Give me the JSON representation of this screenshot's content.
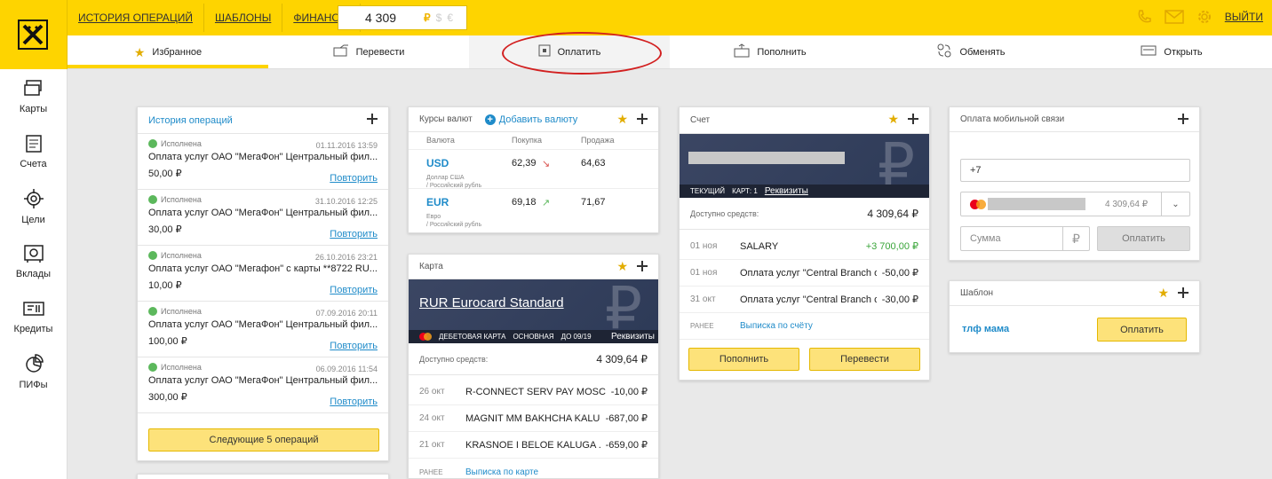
{
  "header": {
    "links": [
      "ИСТОРИЯ ОПЕРАЦИЙ",
      "ШАБЛОНЫ",
      "ФИНАНСЫ"
    ],
    "balance": "4 309",
    "currencies": [
      "₽",
      "$",
      "€"
    ],
    "logout": "ВЫЙТИ"
  },
  "tabs": [
    {
      "label": "Избранное",
      "icon": "star-icon"
    },
    {
      "label": "Перевести",
      "icon": "transfer-icon"
    },
    {
      "label": "Оплатить",
      "icon": "pay-icon"
    },
    {
      "label": "Пополнить",
      "icon": "topup-icon"
    },
    {
      "label": "Обменять",
      "icon": "exchange-icon"
    },
    {
      "label": "Открыть",
      "icon": "open-icon"
    }
  ],
  "sidebar": [
    {
      "label": "Карты",
      "icon": "cards-icon"
    },
    {
      "label": "Счета",
      "icon": "accounts-icon"
    },
    {
      "label": "Цели",
      "icon": "goals-icon"
    },
    {
      "label": "Вклады",
      "icon": "deposits-icon"
    },
    {
      "label": "Кредиты",
      "icon": "credits-icon"
    },
    {
      "label": "ПИФы",
      "icon": "funds-icon"
    }
  ],
  "history": {
    "title": "История операций",
    "items": [
      {
        "status": "Исполнена",
        "date": "01.11.2016 13:59",
        "desc": "Оплата услуг ОАО \"МегаФон\" Центральный фил...",
        "sum": "50,00 ₽",
        "action": "Повторить"
      },
      {
        "status": "Исполнена",
        "date": "31.10.2016 12:25",
        "desc": "Оплата услуг ОАО \"МегаФон\" Центральный фил...",
        "sum": "30,00 ₽",
        "action": "Повторить"
      },
      {
        "status": "Исполнена",
        "date": "26.10.2016 23:21",
        "desc": "Оплата услуг ОАО \"Мегафон\" с карты **8722 RU...",
        "sum": "10,00 ₽",
        "action": "Повторить"
      },
      {
        "status": "Исполнена",
        "date": "07.09.2016 20:11",
        "desc": "Оплата услуг ОАО \"МегаФон\" Центральный фил...",
        "sum": "100,00 ₽",
        "action": "Повторить"
      },
      {
        "status": "Исполнена",
        "date": "06.09.2016 11:54",
        "desc": "Оплата услуг ОАО \"МегаФон\" Центральный фил...",
        "sum": "300,00 ₽",
        "action": "Повторить"
      }
    ],
    "next_button": "Следующие 5 операций"
  },
  "fx": {
    "title": "Курсы валют",
    "add": "Добавить валюту",
    "columns": [
      "Валюта",
      "Покупка",
      "Продажа"
    ],
    "rows": [
      {
        "code": "USD",
        "name1": "Доллар США",
        "name2": "/ Российский рубль",
        "buy": "62,39",
        "sell": "64,63",
        "trend": "down"
      },
      {
        "code": "EUR",
        "name1": "Евро",
        "name2": "/ Российский рубль",
        "buy": "69,18",
        "sell": "71,67",
        "trend": "up"
      }
    ]
  },
  "card": {
    "title": "Карта",
    "name": "RUR Eurocard Standard",
    "type": "ДЕБЕТОВАЯ КАРТА",
    "main": "ОСНОВНАЯ",
    "valid": "ДО 09/19",
    "details": "Реквизиты",
    "avail_label": "Доступно средств:",
    "avail_value": "4 309,64 ₽",
    "transactions": [
      {
        "date": "26 окт",
        "name": "R-CONNECT SERV PAY MOSC...",
        "amount": "-10,00 ₽"
      },
      {
        "date": "24 окт",
        "name": "MAGNIT MM BAKHCHA KALUG...",
        "amount": "-687,00 ₽"
      },
      {
        "date": "21 окт",
        "name": "KRASNOE I BELOE KALUGA ...",
        "amount": "-659,00 ₽"
      }
    ],
    "earlier": "РАНЕЕ",
    "statement": "Выписка по карте"
  },
  "account": {
    "title": "Счет",
    "current": "ТЕКУЩИЙ",
    "cards": "КАРТ: 1",
    "details": "Реквизиты",
    "avail_label": "Доступно средств:",
    "avail_value": "4 309,64 ₽",
    "transactions": [
      {
        "date": "01 ноя",
        "name": "SALARY",
        "amount": "+3 700,00 ₽",
        "positive": true
      },
      {
        "date": "01 ноя",
        "name": "Оплата услуг \"Central Branch of...",
        "amount": "-50,00 ₽",
        "positive": false
      },
      {
        "date": "31 окт",
        "name": "Оплата услуг \"Central Branch of...",
        "amount": "-30,00 ₽",
        "positive": false
      }
    ],
    "earlier": "РАНЕЕ",
    "statement": "Выписка по счёту",
    "topup_button": "Пополнить",
    "transfer_button": "Перевести"
  },
  "mobile": {
    "title": "Оплата мобильной связи",
    "phone_value": "+7",
    "card_balance": "4 309,64 ₽",
    "sum_placeholder": "Сумма",
    "currency": "₽",
    "pay_button": "Оплатить"
  },
  "template": {
    "title": "Шаблон",
    "name": "тлф мама",
    "pay_button": "Оплатить"
  },
  "colors": {
    "brand": "#fed400",
    "link": "#1f8bc9",
    "success": "#5cb85c",
    "annotation": "#d21f1f"
  }
}
